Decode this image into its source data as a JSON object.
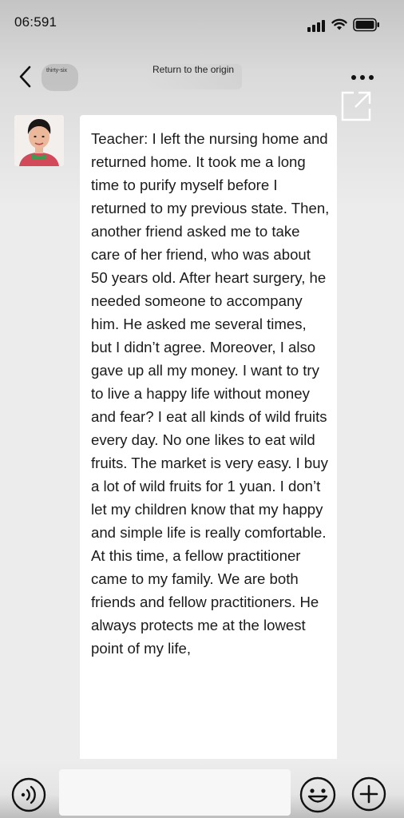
{
  "status_bar": {
    "time": "06:591",
    "icons": [
      "signal-icon",
      "wifi-icon",
      "battery-icon"
    ]
  },
  "nav": {
    "back_icon": "chevron-left-icon",
    "contact_name": "thirty-six",
    "title": "Return to the origin",
    "more_icon": "more-horizontal-icon",
    "share_icon": "external-link-icon"
  },
  "chat": {
    "messages": [
      {
        "sender_avatar": "avatar",
        "text": "Teacher: I left the nursing home and returned home. It took me a long time to purify myself before I returned to my previous state. Then, another friend asked me to take care of her friend, who was about 50 years old. After heart surgery, he needed someone to accompany him. He asked me several times, but I didn’t agree. Moreover, I also gave up all my money. I want to try to live a happy life without money and fear? I eat all kinds of wild fruits every day. No one likes to eat wild fruits. The market is very easy. I buy a lot of wild fruits for 1 yuan. I don’t let my children know that my happy and simple life is really comfortable. At this time, a fellow practitioner came to my family. We are both friends and fellow practitioners. He always protects me at the lowest point of my life,"
      }
    ]
  },
  "input_bar": {
    "voice_icon": "voice-icon",
    "input_value": "",
    "emoji_icon": "emoji-icon",
    "plus_icon": "plus-icon"
  },
  "colors": {
    "page_background": "#ececec",
    "bubble_background": "#ffffff",
    "text": "#1b1b1b"
  }
}
